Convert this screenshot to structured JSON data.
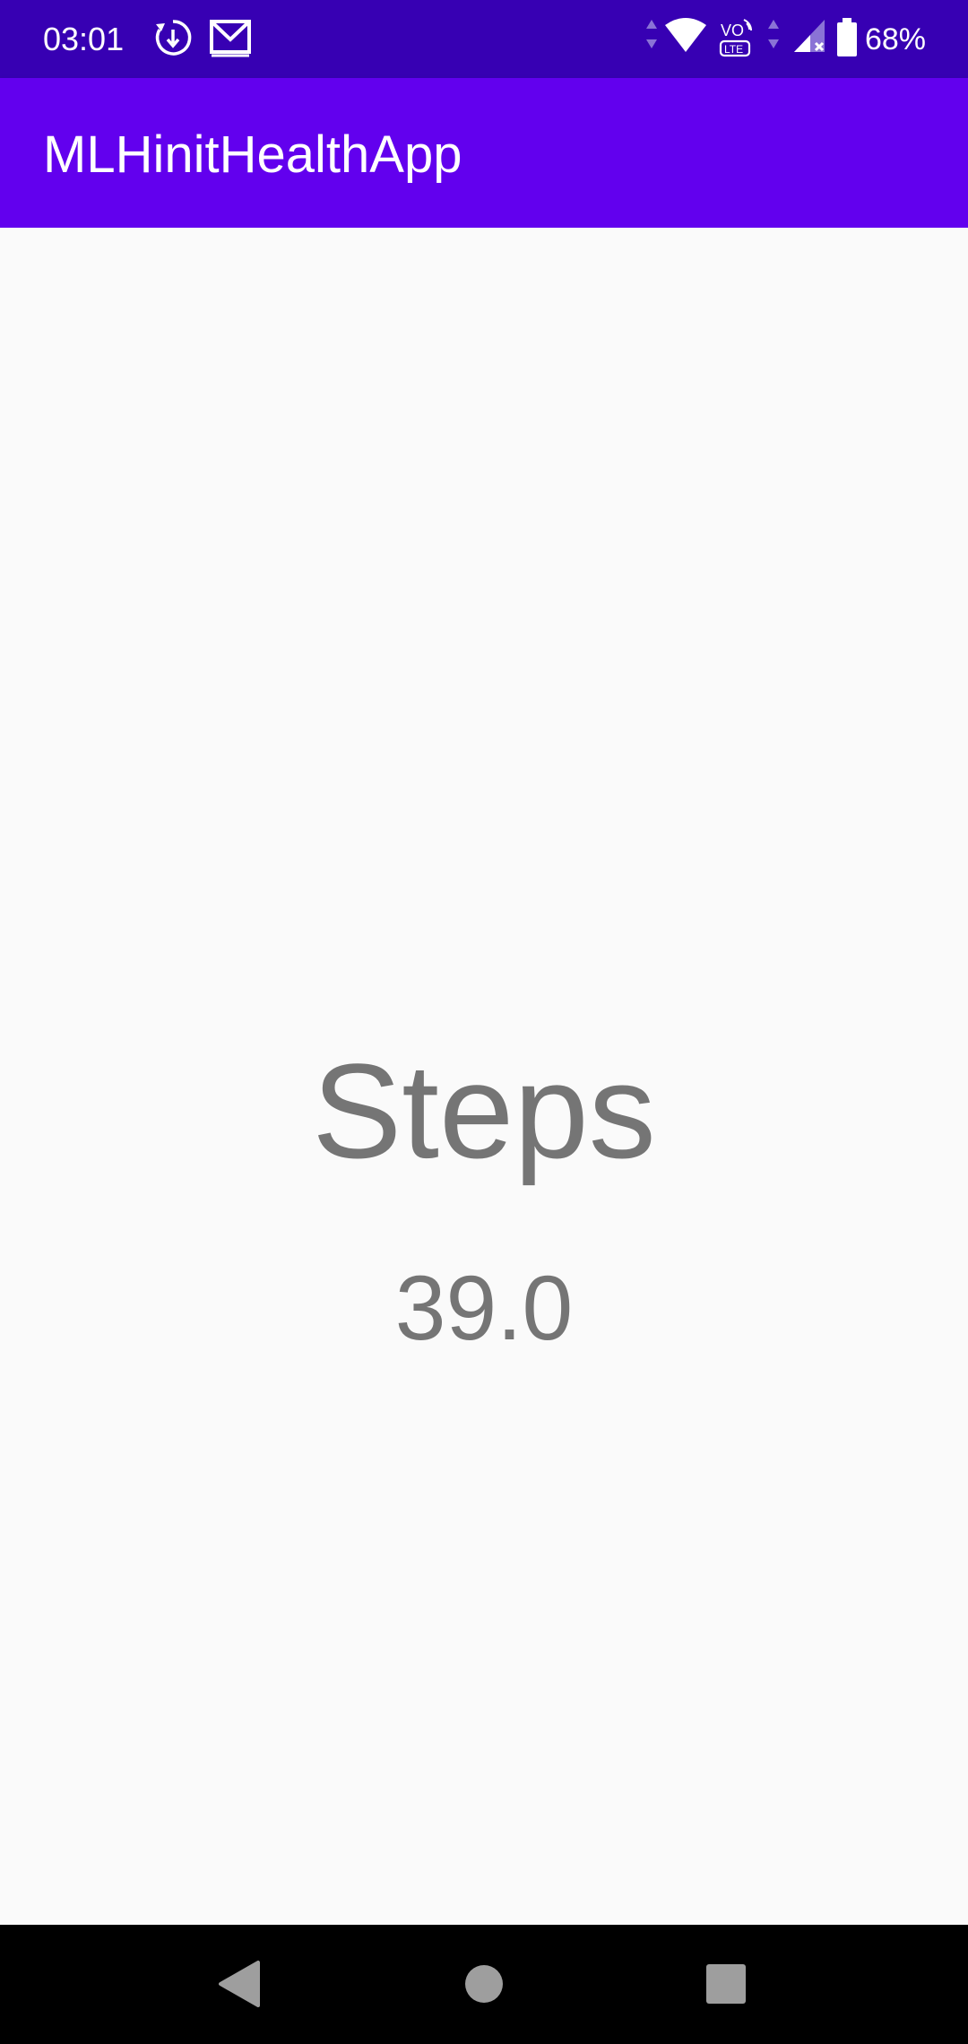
{
  "status_bar": {
    "time": "03:01",
    "battery_percent": "68%",
    "icons": [
      "sync-icon",
      "gmail-icon",
      "data-arrows-icon",
      "wifi-icon",
      "volte-icon",
      "mobile-data-arrows-icon",
      "signal-icon",
      "battery-icon"
    ]
  },
  "app_bar": {
    "title": "MLHinitHealthApp"
  },
  "main": {
    "steps_label": "Steps",
    "steps_value": "39.0"
  },
  "nav_bar": {
    "buttons": [
      "back",
      "home",
      "recents"
    ]
  },
  "colors": {
    "status_bar": "#3700b3",
    "app_bar": "#6200ee",
    "background": "#fafafa",
    "text_gray": "#757575",
    "nav_bar": "#000000"
  }
}
